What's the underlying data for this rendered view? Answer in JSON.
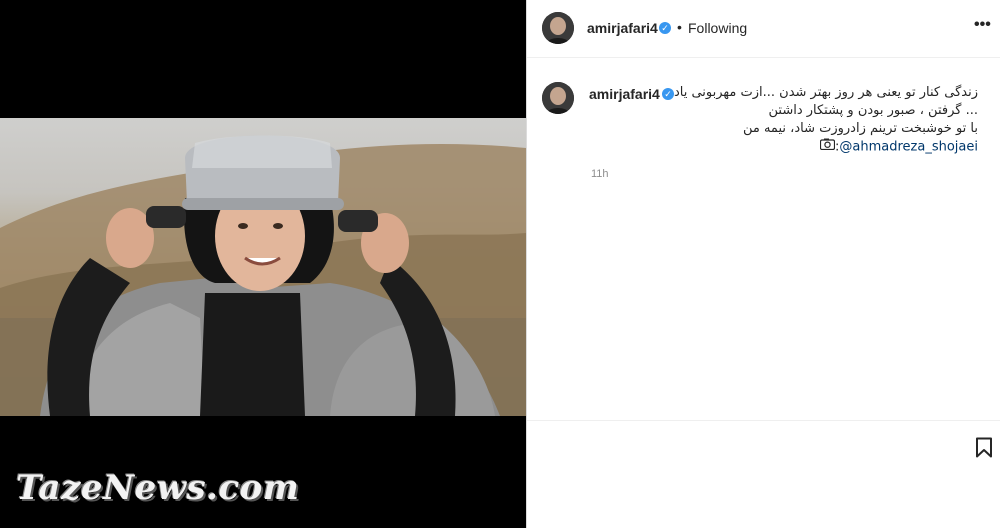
{
  "post": {
    "author": {
      "username": "amirjafari4",
      "verified": true,
      "follow_status": "Following",
      "separator": "•"
    },
    "more_options_icon": "more-horizontal-icon",
    "caption": {
      "line1": "زندگی کنار تو یعنی هر روز بهتر شدن ...ازت مهربونی یاد",
      "line2": "... گرفتن ، صبور بودن و پشتکار داشتن",
      "line3": "با تو خوشبخت ترینم زادروزت شاد، نیمه من",
      "mention_prefix": ":",
      "mention": "@ahmadreza_shojaei"
    },
    "timestamp": "11h",
    "bookmark_icon": "bookmark-icon"
  },
  "media": {
    "watermark": "TazeNews.com"
  },
  "colors": {
    "verified_blue": "#3897f0",
    "mention_blue": "#00376b",
    "muted_gray": "#8e8e8e"
  }
}
